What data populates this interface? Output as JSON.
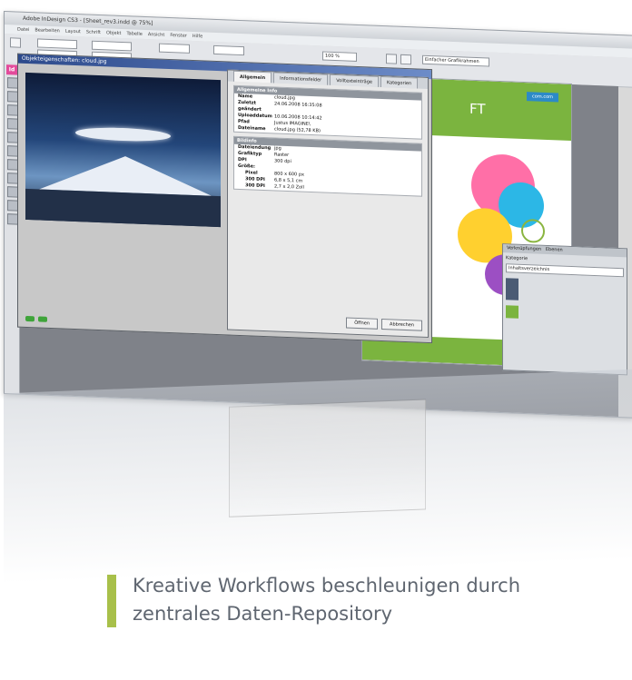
{
  "app": {
    "title": "Adobe InDesign CS3 - [Sheet_rev3.indd @ 75%]"
  },
  "menu": [
    "Datei",
    "Bearbeiten",
    "Layout",
    "Schrift",
    "Objekt",
    "Tabelle",
    "Ansicht",
    "Fenster",
    "Hilfe"
  ],
  "toolbar": {
    "zoom_value": "100 %",
    "style_value": "Einfacher Grafikrahmen"
  },
  "tool_logo": "Id",
  "props_window": {
    "title": "Objekteigenschaften: cloud.jpg"
  },
  "dialog": {
    "tabs": [
      "Allgemein",
      "Informationsfelder",
      "Volltexteinträge",
      "Kategorien"
    ],
    "section1": {
      "heading": "Allgemeine Info",
      "rows": [
        {
          "k": "Name",
          "v": "cloud.jpg"
        },
        {
          "k": "Zuletzt geändert",
          "v": "24.06.2008 16:35:08"
        },
        {
          "k": "Uploaddatum",
          "v": "10.06.2008 10:14:42"
        },
        {
          "k": "Pfad",
          "v": "Justus IMAGINE\\"
        },
        {
          "k": "Dateiname",
          "v": "cloud.jpg (52,78 KB)"
        }
      ]
    },
    "section2": {
      "heading": "Bildinfo",
      "rows": [
        {
          "k": "Dateiendung",
          "v": "jpg"
        },
        {
          "k": "Grafiktyp",
          "v": "Raster"
        },
        {
          "k": "DPI",
          "v": "300 dpi"
        },
        {
          "k": "Größe:",
          "v": ""
        },
        {
          "k": "Pixel",
          "v": "800 x 600 px"
        },
        {
          "k": "300 DPI",
          "v": "6,8 x 5,1 cm"
        },
        {
          "k": "300 DPI",
          "v": "2,7 x 2,0 Zoll"
        }
      ]
    },
    "buttons": {
      "open": "Öffnen",
      "cancel": "Abbrechen"
    }
  },
  "document": {
    "heading": "FT",
    "badge": "com.com"
  },
  "panel": {
    "tab1": "Verknüpfungen",
    "tab2": "Ebenen",
    "label": "Kategorie",
    "field": "Inhaltsverzeichnis"
  },
  "caption": {
    "line1": "Kreative Workflows beschleunigen durch",
    "line2": "zentrales Daten-Repository"
  },
  "colors": {
    "accent_bar": "#a8c04a",
    "doc_green": "#7bb43f",
    "caption_text": "#5f6670"
  }
}
